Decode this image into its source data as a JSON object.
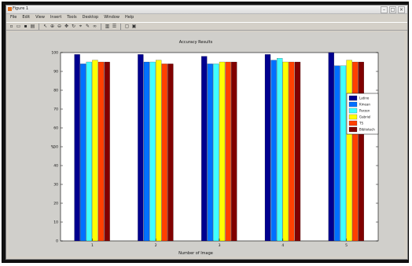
{
  "window": {
    "title": "Figure 1",
    "controls": {
      "minimize": "–",
      "maximize": "□",
      "close": "×"
    }
  },
  "menus": [
    "File",
    "Edit",
    "View",
    "Insert",
    "Tools",
    "Desktop",
    "Window",
    "Help"
  ],
  "toolbar_icons": [
    "new-figure-icon",
    "open-file-icon",
    "save-icon",
    "print-icon",
    "edit-plot-icon",
    "zoom-in-icon",
    "zoom-out-icon",
    "pan-icon",
    "rotate-icon",
    "data-cursor-icon",
    "brush-icon",
    "link-icon",
    "colorbar-icon",
    "legend-icon",
    "hide-tools-icon",
    "show-tools-icon"
  ],
  "chart_data": {
    "type": "bar",
    "title": "Accuracy Results",
    "xlabel": "Number of Image",
    "ylabel": "%",
    "categories": [
      "1",
      "2",
      "3",
      "4",
      "5"
    ],
    "ylim": [
      0,
      100
    ],
    "yticks": [
      "0",
      "10",
      "20",
      "30",
      "40",
      "50",
      "60",
      "70",
      "80",
      "90",
      "100"
    ],
    "grid": false,
    "legend_position": "right",
    "series": [
      {
        "name": "Latino",
        "color": "#00008f",
        "values": [
          99,
          99,
          98,
          99,
          100
        ]
      },
      {
        "name": "Kmean",
        "color": "#0070ff",
        "values": [
          94,
          95,
          94,
          96,
          93
        ]
      },
      {
        "name": "Parzen",
        "color": "#40ffff",
        "values": [
          95,
          95,
          94,
          97,
          93
        ]
      },
      {
        "name": "Gabriel",
        "color": "#ffff00",
        "values": [
          96,
          96,
          95,
          95,
          96
        ]
      },
      {
        "name": "TS",
        "color": "#ff4000",
        "values": [
          95,
          94,
          95,
          95,
          95
        ]
      },
      {
        "name": "Bibliotech",
        "color": "#800000",
        "values": [
          95,
          94,
          95,
          95,
          95
        ]
      }
    ]
  }
}
